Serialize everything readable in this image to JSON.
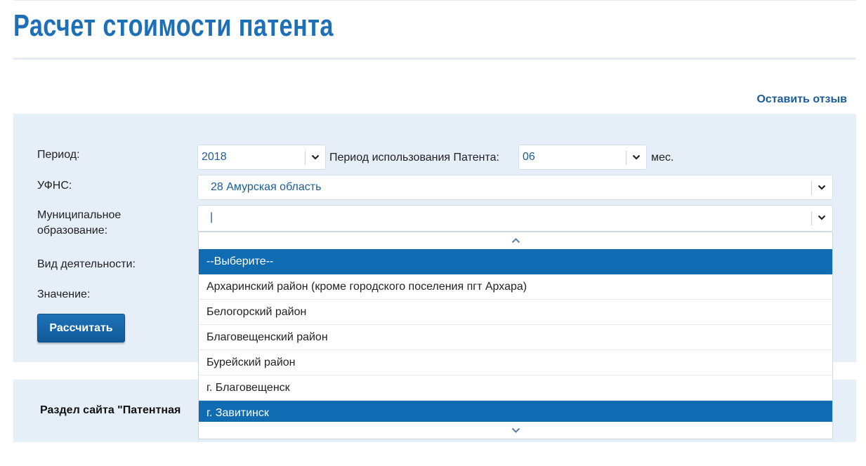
{
  "page": {
    "title": "Расчет стоимости патента"
  },
  "links": {
    "feedback": "Оставить отзыв"
  },
  "form": {
    "period_label": "Период:",
    "period_value": "2018",
    "usage_period_label": "Период использования Патента:",
    "usage_period_value": "06",
    "usage_period_unit": "мес.",
    "ufns_label": "УФНС:",
    "ufns_value": "28 Амурская область",
    "municipality_label_line1": "Муниципальное",
    "municipality_label_line2": "образование:",
    "municipality_value": "|",
    "activity_label": "Вид деятельности:",
    "value_label": "Значение:",
    "calculate_button": "Рассчитать"
  },
  "bottom": {
    "section_text": "Раздел сайта \"Патентная"
  },
  "municipality_dropdown": {
    "options": [
      "--Выберите--",
      "Архаринский район (кроме городского поселения пгт Архара)",
      "Белогорский район",
      "Благовещенский район",
      "Бурейский район",
      "г. Благовещенск",
      "г. Завитинск"
    ],
    "highlighted": [
      "--Выберите--",
      "г. Завитинск"
    ]
  },
  "icons": {
    "dropdown": "chevron-down-icon",
    "scroll_up": "chevron-up-icon",
    "scroll_down": "chevron-down-icon"
  },
  "colors": {
    "accent": "#1d6fb8",
    "panel": "#e6eef8",
    "selected": "#0f6cb3",
    "link": "#1a5c9a"
  }
}
